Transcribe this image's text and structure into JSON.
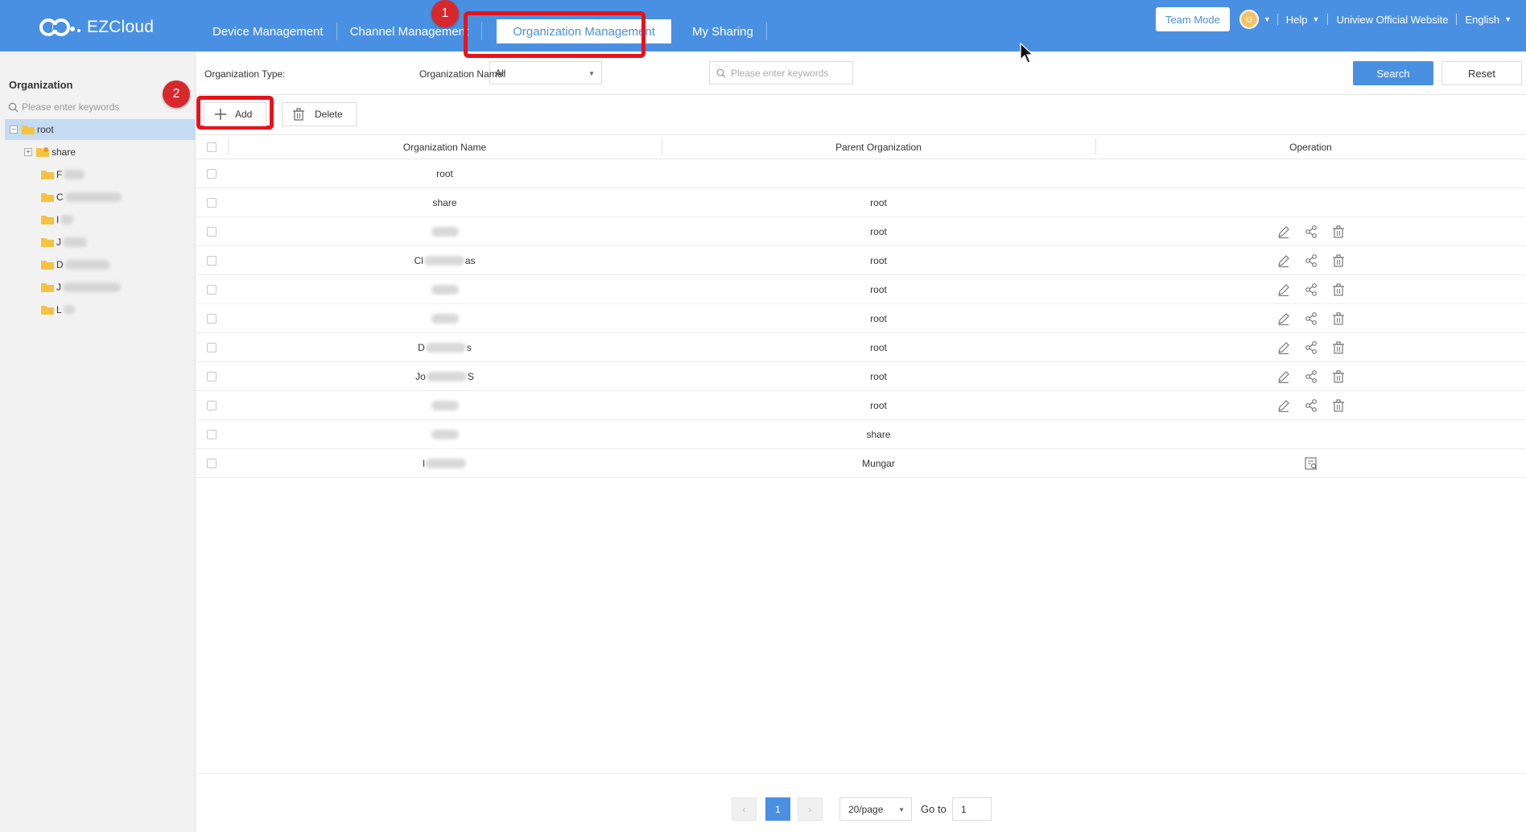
{
  "header": {
    "logo_text": "EZCloud",
    "nav": [
      {
        "label": "Device Management"
      },
      {
        "label": "Channel Management"
      },
      {
        "label": "Organization Management",
        "active": true
      },
      {
        "label": "My Sharing"
      }
    ],
    "team_mode": "Team Mode",
    "help": "Help",
    "official_site": "Uniview Official Website",
    "language": "English"
  },
  "annotations": {
    "step1": "1",
    "step2": "2"
  },
  "sidebar": {
    "title": "Organization",
    "search_placeholder": "Please enter keywords",
    "tree": [
      {
        "label": "root",
        "level": 0,
        "selected": true,
        "type": "folder"
      },
      {
        "label": "share",
        "level": 1,
        "type": "shared-folder"
      },
      {
        "label": "F",
        "level": 2,
        "type": "folder"
      },
      {
        "label": "C",
        "level": 2,
        "type": "folder"
      },
      {
        "label": "I",
        "level": 2,
        "type": "folder"
      },
      {
        "label": "J",
        "level": 2,
        "type": "folder"
      },
      {
        "label": "D",
        "level": 2,
        "type": "folder"
      },
      {
        "label": "J",
        "level": 2,
        "type": "folder"
      },
      {
        "label": "L",
        "level": 2,
        "type": "folder"
      }
    ]
  },
  "filters": {
    "org_type_label": "Organization Type:",
    "org_type_value": "All",
    "org_name_label": "Organization Name:",
    "org_name_placeholder": "Please enter keywords",
    "search_btn": "Search",
    "reset_btn": "Reset"
  },
  "toolbar": {
    "add": "Add",
    "delete": "Delete"
  },
  "table": {
    "columns": [
      "Organization Name",
      "Parent Organization",
      "Operation"
    ],
    "rows": [
      {
        "name": "root",
        "parent": "",
        "ops": "none"
      },
      {
        "name": "share",
        "parent": "root",
        "ops": "none"
      },
      {
        "name": "",
        "parent": "root",
        "ops": "full"
      },
      {
        "name": "Cl",
        "name_tail": "as",
        "parent": "root",
        "ops": "full"
      },
      {
        "name": "",
        "parent": "root",
        "ops": "full"
      },
      {
        "name": "",
        "parent": "root",
        "ops": "full"
      },
      {
        "name": "D",
        "name_tail": "s",
        "parent": "root",
        "ops": "full"
      },
      {
        "name": "Jo",
        "name_tail": "S",
        "parent": "root",
        "ops": "full"
      },
      {
        "name": "",
        "parent": "root",
        "ops": "full"
      },
      {
        "name": "",
        "parent": "share",
        "ops": "none"
      },
      {
        "name": "I",
        "name_tail": "",
        "parent": "Mungar",
        "ops": "view"
      }
    ]
  },
  "pagination": {
    "current_page": "1",
    "page_size": "20/page",
    "goto_label": "Go to",
    "goto_value": "1"
  }
}
